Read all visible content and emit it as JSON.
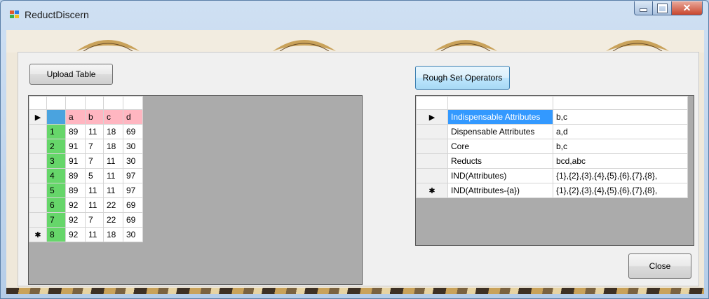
{
  "window": {
    "title": "ReductDiscern"
  },
  "buttons": {
    "upload": "Upload Table",
    "rough": "Rough Set Operators",
    "close": "Close"
  },
  "markers": {
    "current": "▶",
    "new": "✱"
  },
  "table1": {
    "columns": [
      "a",
      "b",
      "c",
      "d"
    ],
    "rows": [
      {
        "id": "1",
        "a": "89",
        "b": "11",
        "c": "18",
        "d": "69"
      },
      {
        "id": "2",
        "a": "91",
        "b": "7",
        "c": "18",
        "d": "30"
      },
      {
        "id": "3",
        "a": "91",
        "b": "7",
        "c": "11",
        "d": "30"
      },
      {
        "id": "4",
        "a": "89",
        "b": "5",
        "c": "11",
        "d": "97"
      },
      {
        "id": "5",
        "a": "89",
        "b": "11",
        "c": "11",
        "d": "97"
      },
      {
        "id": "6",
        "a": "92",
        "b": "11",
        "c": "22",
        "d": "69"
      },
      {
        "id": "7",
        "a": "92",
        "b": "7",
        "c": "22",
        "d": "69"
      },
      {
        "id": "8",
        "a": "92",
        "b": "11",
        "c": "18",
        "d": "30"
      }
    ]
  },
  "table2": {
    "rows": [
      {
        "attr": "Indispensable Attributes",
        "value": "b,c"
      },
      {
        "attr": "Dispensable Attributes",
        "value": "a,d"
      },
      {
        "attr": "Core",
        "value": "b,c"
      },
      {
        "attr": "Reducts",
        "value": "bcd,abc"
      },
      {
        "attr": "IND(Attributes)",
        "value": "{1},{2},{3},{4},{5},{6},{7},{8},"
      },
      {
        "attr": "IND(Attributes-{a})",
        "value": "{1},{2},{3},{4},{5},{6},{7},{8},"
      }
    ]
  },
  "colors": {
    "id_cell": "#66d66a",
    "header_cell": "#ffb6c1",
    "selection": "#3399ff"
  }
}
